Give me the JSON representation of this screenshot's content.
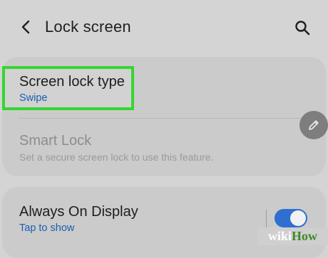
{
  "header": {
    "title": "Lock screen",
    "back_icon": "chevron-left-icon",
    "search_icon": "search-icon"
  },
  "settings_card": {
    "items": [
      {
        "title": "Screen lock type",
        "subtitle": "Swipe",
        "enabled": true
      },
      {
        "title": "Smart Lock",
        "subtitle": "Set a secure screen lock to use this feature.",
        "enabled": false
      }
    ],
    "edit_icon": "pencil-icon"
  },
  "aod_card": {
    "title": "Always On Display",
    "subtitle": "Tap to show",
    "toggle_on": true
  },
  "watermark": {
    "part1": "wiki",
    "part2": "How"
  },
  "colors": {
    "highlight": "#36d62f",
    "accent_blue": "#2e6fd0",
    "background": "#d4d4d4"
  }
}
